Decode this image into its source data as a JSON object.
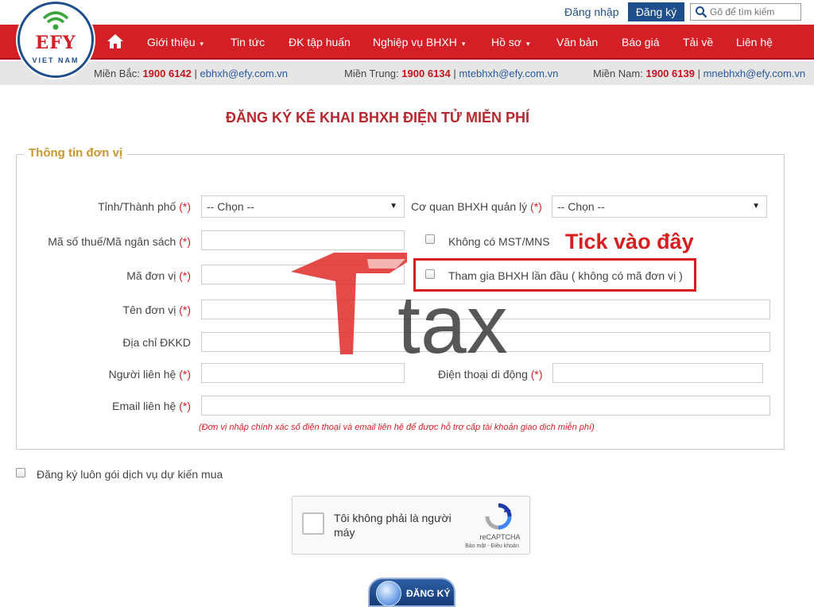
{
  "header": {
    "login_label": "Đăng nhập",
    "register_label": "Đăng ký",
    "search_placeholder": "Gõ để tìm kiếm"
  },
  "logo": {
    "text": "EFY",
    "subtext": "VIET NAM"
  },
  "nav": {
    "items": [
      {
        "label": "Giới thiệu",
        "caret": "▾"
      },
      {
        "label": "Tin tức",
        "caret": ""
      },
      {
        "label": "ĐK tập huấn",
        "caret": ""
      },
      {
        "label": "Nghiệp vụ BHXH",
        "caret": "▾"
      },
      {
        "label": "Hồ sơ",
        "caret": "▾"
      },
      {
        "label": "Văn bản",
        "caret": ""
      },
      {
        "label": "Báo giá",
        "caret": ""
      },
      {
        "label": "Tải về",
        "caret": ""
      },
      {
        "label": "Liên hệ",
        "caret": ""
      }
    ]
  },
  "hotline": {
    "north": {
      "prefix": "Miền Bắc:",
      "phone": "1900 6142",
      "email": "ebhxh@efy.com.vn"
    },
    "central": {
      "prefix": "Miền Trung:",
      "phone": "1900 6134",
      "email": "mtebhxh@efy.com.vn"
    },
    "south": {
      "prefix": "Miền Nam:",
      "phone": "1900 6139",
      "email": "mnebhxh@efy.com.vn"
    },
    "separator": "|"
  },
  "page_title": "ĐĂNG KÝ KÊ KHAI BHXH ĐIỆN TỬ MIỄN PHÍ",
  "form": {
    "legend": "Thông tin đơn vị",
    "required_mark": "(*)",
    "province_label": "Tỉnh/Thành phố",
    "province_value": "-- Chọn --",
    "agency_label": "Cơ quan BHXH quản lý",
    "agency_value": "-- Chọn --",
    "tax_code_label": "Mã số thuế/Mã ngân sách",
    "no_tax_label": "Không có MST/MNS",
    "unit_code_label": "Mã đơn vị",
    "first_time_label": "Tham gia BHXH lần đầu ( không có mã đơn vị )",
    "unit_name_label": "Tên đơn vị",
    "address_label": "Địa chỉ ĐKKD",
    "contact_label": "Người liên hệ",
    "mobile_label": "Điện thoại di động",
    "email_label": "Email liên hệ",
    "note": "(Đơn vị nhập chính xác số điện thoại và email liên hệ để được hỗ trợ cấp tài khoản giao dịch miễn phí)"
  },
  "annotation": {
    "tick_note": "Tick vào đây",
    "highlight_color": "#d81e1e"
  },
  "service_label": "Đăng ký luôn gói dịch vụ dự kiến mua",
  "captcha": {
    "label": "Tôi không phải là người máy",
    "brand": "reCAPTCHA",
    "links": "Bảo mật - Điều khoản"
  },
  "submit_label": "ĐĂNG KÝ",
  "watermark": {
    "text": "tax",
    "color": "#e0312e"
  },
  "colors": {
    "nav_red": "#d41f26",
    "brand_blue": "#1f4e8c",
    "title_red": "#b7282e",
    "legend_gold": "#c8962e"
  }
}
